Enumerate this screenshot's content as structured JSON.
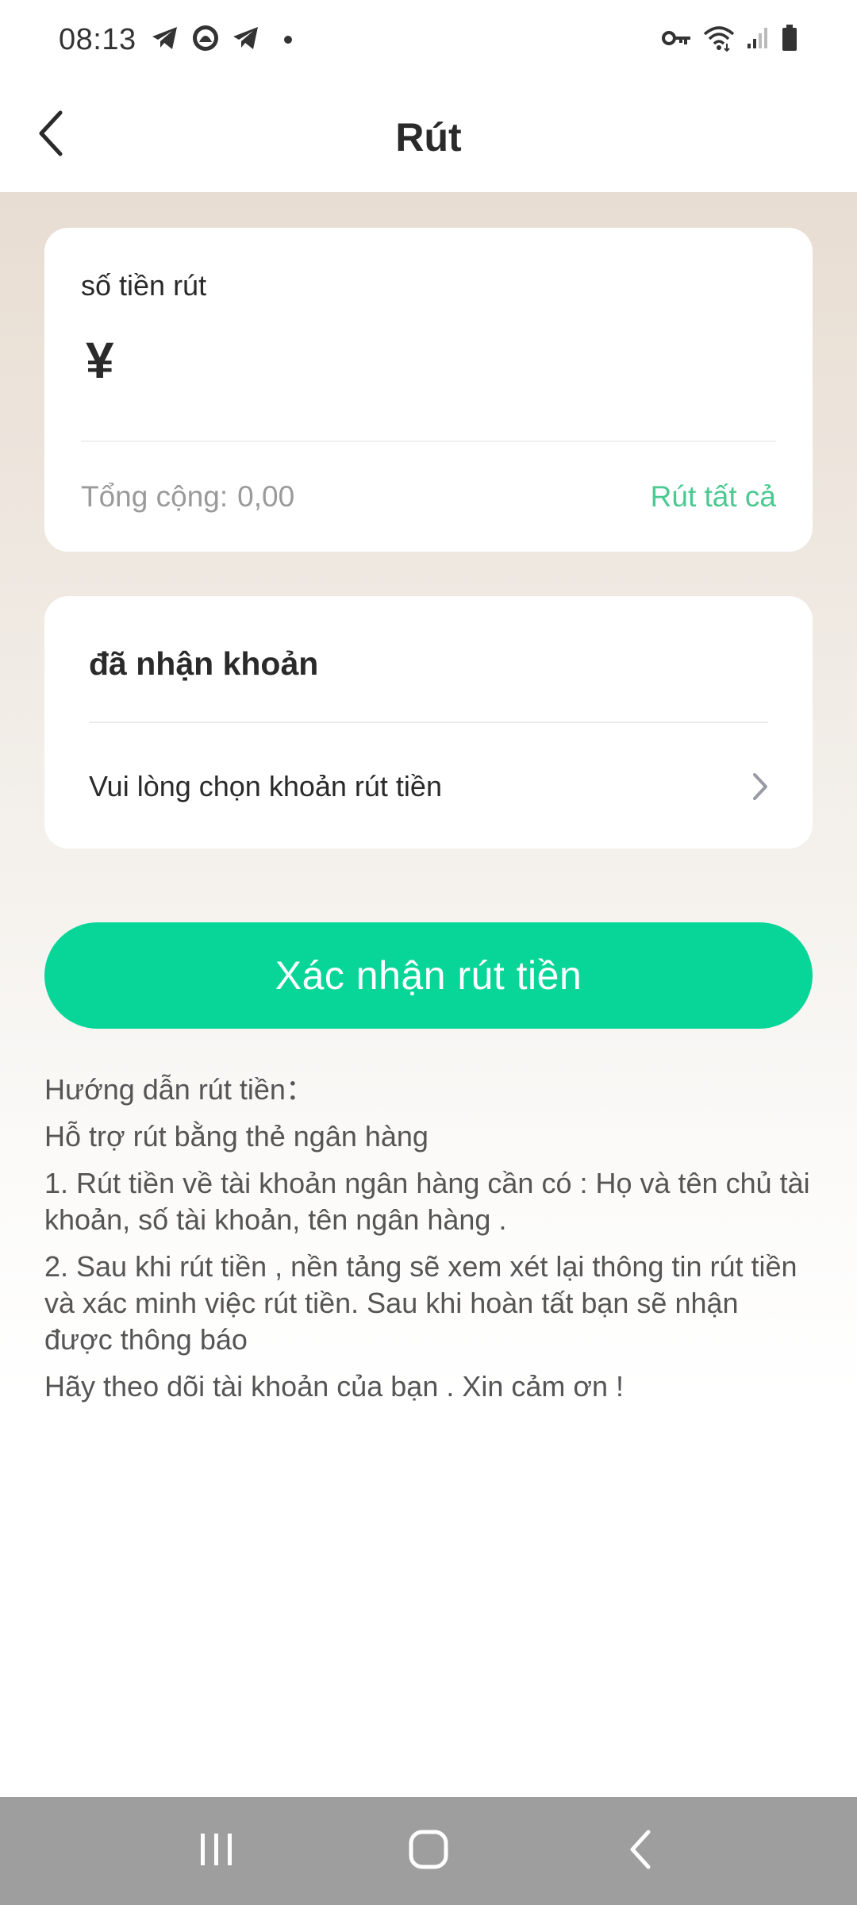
{
  "status_bar": {
    "time": "08:13",
    "left_icons": [
      "telegram-icon",
      "app-icon",
      "telegram-icon",
      "notification-dot-icon"
    ],
    "right_icons": [
      "key-icon",
      "wifi-icon",
      "signal-icon",
      "battery-icon"
    ]
  },
  "header": {
    "title": "Rút",
    "back_icon": "chevron-left-icon"
  },
  "amount_card": {
    "label": "số tiền rút",
    "currency_symbol": "¥",
    "input_value": "",
    "total_label": "Tổng cộng:",
    "total_value": "0,00",
    "withdraw_all_label": "Rút tất cả"
  },
  "account_card": {
    "title": "đã nhận khoản",
    "placeholder": "Vui lòng chọn khoản rút tiền",
    "chevron_icon": "chevron-right-icon"
  },
  "confirm_button": {
    "label": "Xác nhận rút tiền"
  },
  "guide": {
    "heading": "Hướng dẫn rút tiền：",
    "lines": [
      "Hỗ trợ rút bằng thẻ ngân hàng",
      "1. Rút tiền về tài khoản ngân hàng cần có : Họ và tên chủ tài khoản, số tài khoản, tên ngân hàng .",
      "2. Sau khi rút tiền , nền tảng sẽ xem xét lại thông tin rút tiền và xác minh việc rút tiền. Sau khi hoàn tất bạn sẽ nhận được thông báo",
      "Hãy theo dõi tài khoản của bạn . Xin cảm ơn !"
    ]
  },
  "nav_bar": {
    "buttons": [
      "recent-apps-icon",
      "home-icon",
      "back-icon"
    ]
  },
  "colors": {
    "accent_green": "#07d698",
    "link_green": "#4cc991",
    "nav_bar_gray": "#9e9e9e",
    "header_gradient_top": "#e8ddd2"
  }
}
